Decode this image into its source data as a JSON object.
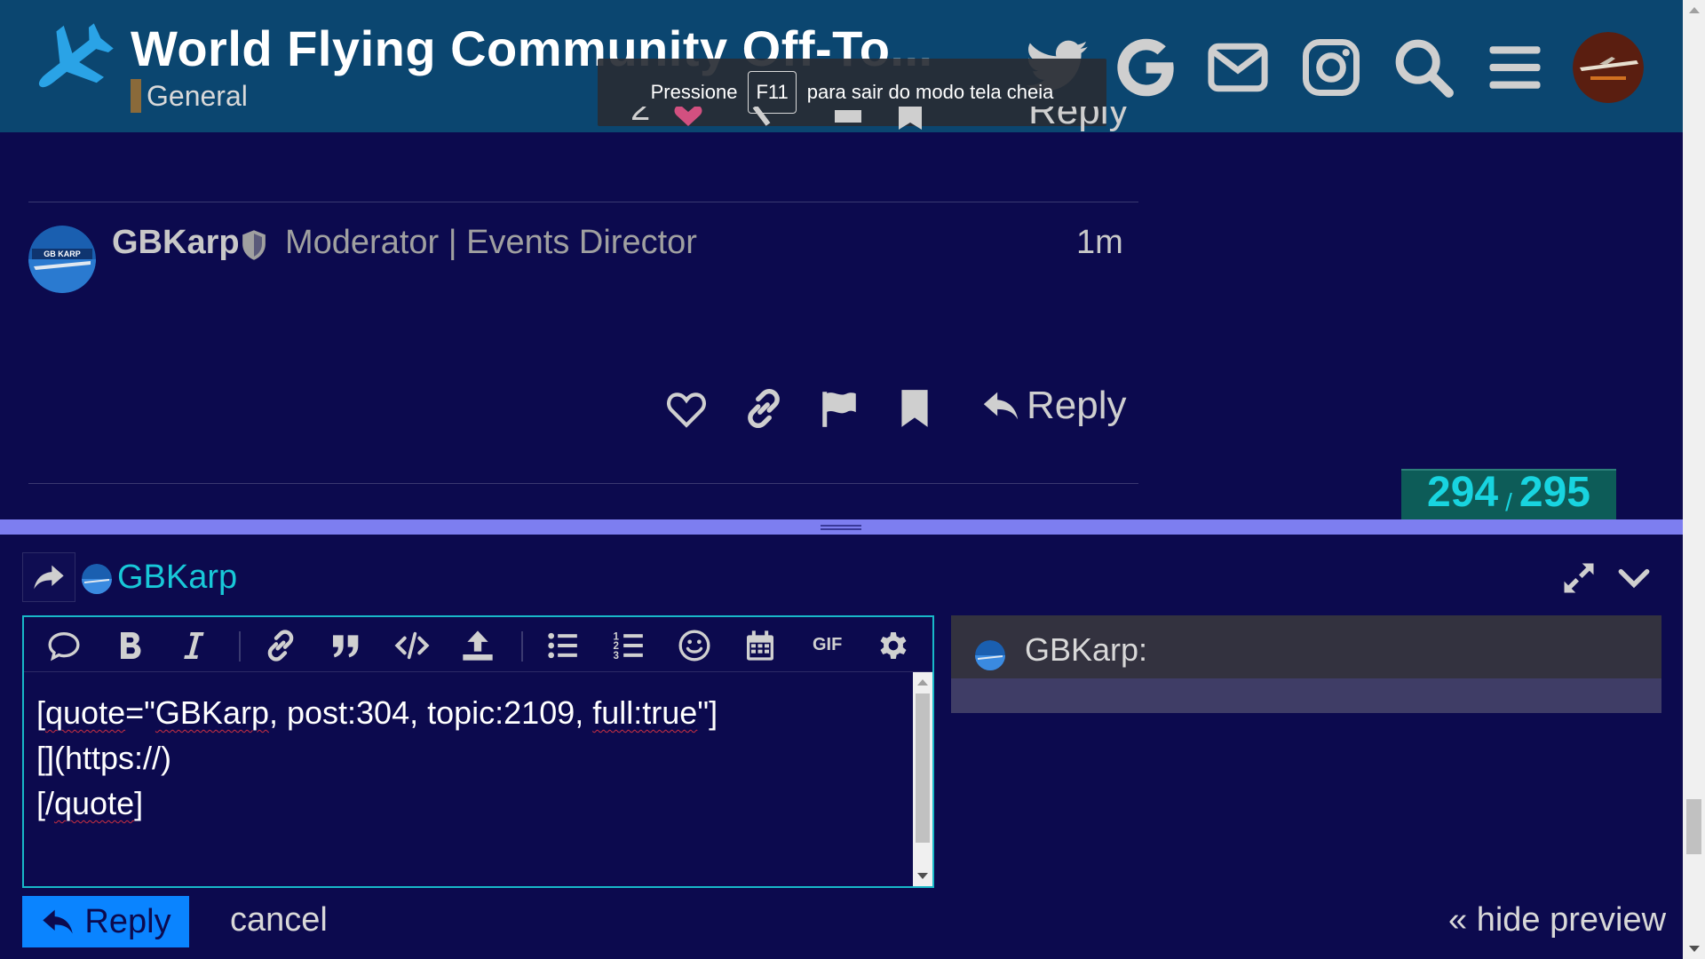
{
  "header": {
    "title": "World Flying Community Off-To...",
    "category": "General",
    "category_color": "#8a6a3a",
    "background": "#0b4670",
    "icons": [
      "plane-icon",
      "twitter-icon",
      "google-icon",
      "mail-icon",
      "instagram-icon",
      "search-icon",
      "hamburger-icon",
      "avatar"
    ]
  },
  "fullscreen_toast": {
    "before": "Pressione",
    "key": "F11",
    "after": "para sair do modo tela cheia"
  },
  "post": {
    "username": "GBKarp",
    "user_title": "Moderator | Events Director",
    "time": "1m",
    "actions": [
      "like-icon",
      "link-icon",
      "flag-icon",
      "bookmark-icon"
    ],
    "reply_label": "Reply",
    "avatar_caption": "GB KARP"
  },
  "previous_post": {
    "like_count": "2",
    "reply_label": "Reply"
  },
  "timeline": {
    "current": "294",
    "separator": "/",
    "total": "295"
  },
  "composer": {
    "reply_to": "GBKarp",
    "toolbar": [
      "quote-icon",
      "bold-icon",
      "italic-icon",
      "link-icon",
      "blockquote-icon",
      "code-icon",
      "upload-icon",
      "bullet-list-icon",
      "numbered-list-icon",
      "emoji-icon",
      "calendar-icon",
      "gif-button",
      "gear-icon"
    ],
    "gif_label": "GIF",
    "text_lines": {
      "l1_a": "[",
      "l1_b": "quote",
      "l1_c": "=\"",
      "l1_d": "GBKarp",
      "l1_e": ", post:304, topic:2109, ",
      "l1_f": "full:true",
      "l1_g": "\"]",
      "l2": "[](https://)",
      "l3_a": "[/",
      "l3_b": "quote",
      "l3_c": "]"
    },
    "preview_name": "GBKarp:",
    "reply_button": "Reply",
    "cancel": "cancel",
    "hide_preview": "« hide preview"
  }
}
